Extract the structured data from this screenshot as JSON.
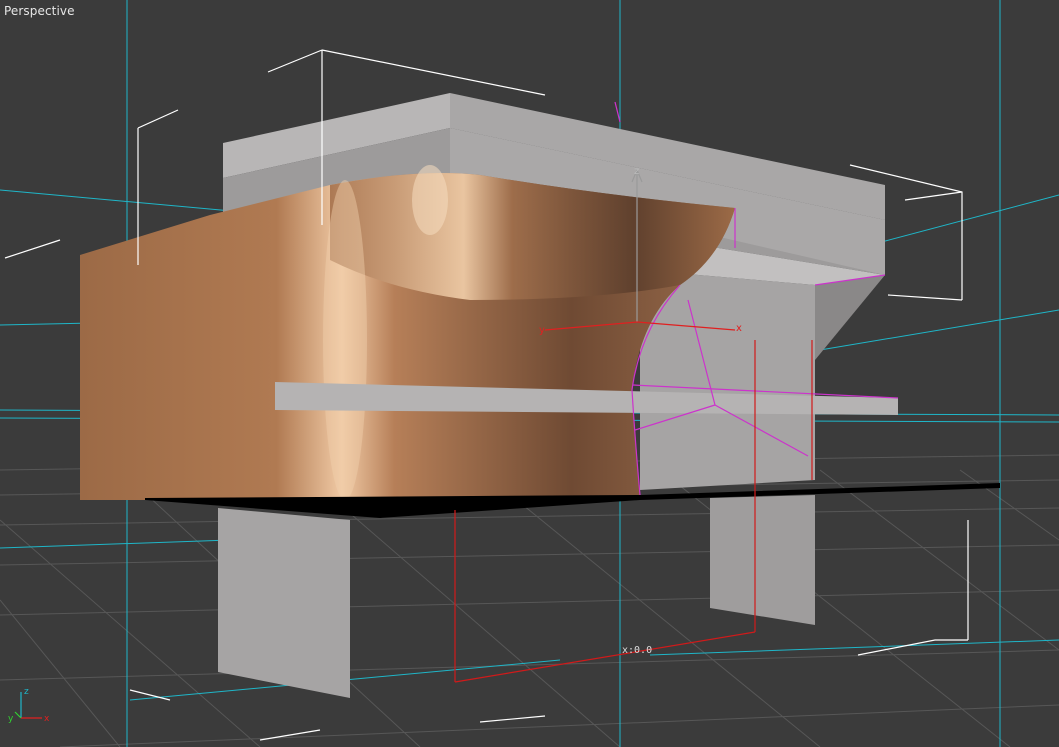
{
  "viewport": {
    "label": "Perspective",
    "background_color": "#3b3b3b",
    "grid_color": "#5a5a5a",
    "home_grid_color": "#000000"
  },
  "gizmo": {
    "x_label": "x",
    "y_label": "y",
    "z_label": "z",
    "x_color": "#e02020",
    "y_color": "#e02020",
    "z_color": "#9a9a9a"
  },
  "coordinate_readout": "x:0.0",
  "axis_tripod": {
    "x": "x",
    "y": "y",
    "z": "z"
  },
  "objects": {
    "surface_color": "#b07a52",
    "box_color": "#a7a5a5",
    "selection_color": "#cc33cc",
    "bounding_box_color": "#ffffff",
    "guide_color": "#1fb6c8"
  }
}
